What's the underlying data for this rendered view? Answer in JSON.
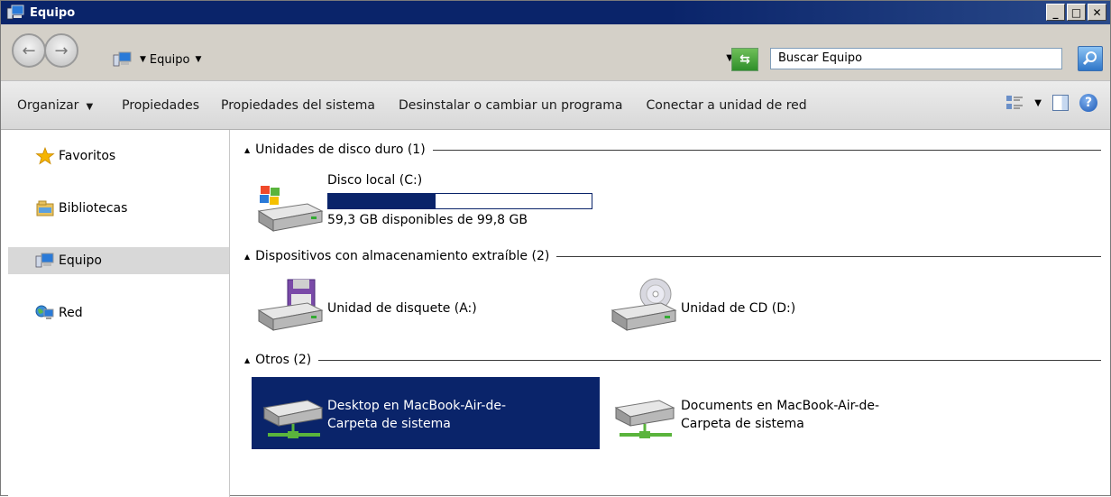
{
  "window": {
    "title": "Equipo",
    "buttons": {
      "minimize": "_",
      "maximize": "□",
      "close": "✕"
    }
  },
  "address": {
    "crumb": "Equipo",
    "search_placeholder": "Buscar Equipo"
  },
  "toolbar": {
    "organize": "Organizar",
    "properties": "Propiedades",
    "system_properties": "Propiedades del sistema",
    "uninstall": "Desinstalar o cambiar un programa",
    "map_drive": "Conectar a unidad de red"
  },
  "sidebar": {
    "items": [
      {
        "label": "Favoritos",
        "icon": "star-icon"
      },
      {
        "label": "Bibliotecas",
        "icon": "library-icon"
      },
      {
        "label": "Equipo",
        "icon": "computer-icon"
      },
      {
        "label": "Red",
        "icon": "network-icon"
      }
    ],
    "selected": "Equipo"
  },
  "groups": {
    "hard_disks": {
      "title": "Unidades de disco duro (1)",
      "items": [
        {
          "name": "Disco local (C:)",
          "free_text": "59,3 GB disponibles de 99,8 GB",
          "used_fraction": 0.406
        }
      ]
    },
    "removable": {
      "title": "Dispositivos con almacenamiento extraíble (2)",
      "items": [
        {
          "name": "Unidad de disquete (A:)"
        },
        {
          "name": "Unidad de CD (D:)"
        }
      ]
    },
    "other": {
      "title": "Otros (2)",
      "items": [
        {
          "line1": "Desktop en MacBook-Air-de-",
          "line2": "Carpeta de sistema",
          "selected": true
        },
        {
          "line1": "Documents en MacBook-Air-de-",
          "line2": "Carpeta de sistema",
          "selected": false
        }
      ]
    }
  },
  "colors": {
    "titlebar": "#0a246a",
    "selection": "#0a246a",
    "chrome": "#d4d0c8"
  }
}
